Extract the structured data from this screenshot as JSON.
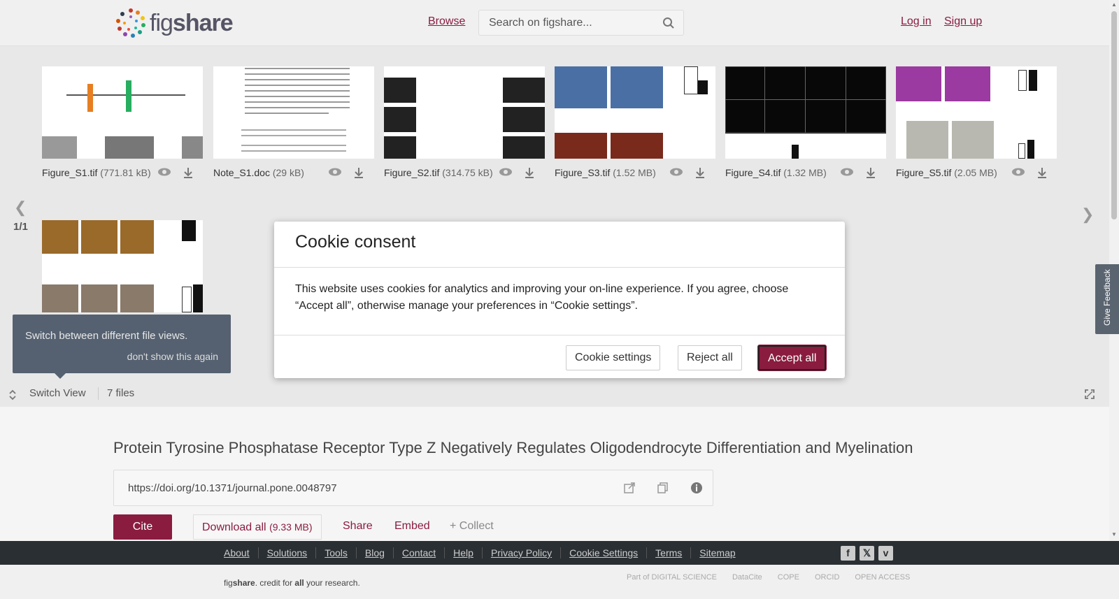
{
  "header": {
    "logo_text_fig": "fig",
    "logo_text_share": "share",
    "browse": "Browse",
    "search_placeholder": "Search on figshare...",
    "login": "Log in",
    "signup": "Sign up"
  },
  "files": [
    {
      "name": "Figure_S1.tif",
      "size": "(771.81 kB)"
    },
    {
      "name": "Note_S1.doc",
      "size": "(29 kB)"
    },
    {
      "name": "Figure_S2.tif",
      "size": "(314.75 kB)"
    },
    {
      "name": "Figure_S3.tif",
      "size": "(1.52 MB)"
    },
    {
      "name": "Figure_S4.tif",
      "size": "(1.32 MB)"
    },
    {
      "name": "Figure_S5.tif",
      "size": "(2.05 MB)"
    }
  ],
  "viewer": {
    "pager": "1/1",
    "tooltip_text": "Switch between different file views.",
    "tooltip_dismiss": "don't show this again",
    "switch_view": "Switch View",
    "file_count": "7 files"
  },
  "article": {
    "title": "Protein Tyrosine Phosphatase Receptor Type Z Negatively Regulates Oligodendrocyte Differentiation and Myelination",
    "doi": "https://doi.org/10.1371/journal.pone.0048797",
    "cite": "Cite",
    "download_all": "Download all",
    "download_size": "(9.33 MB)",
    "share": "Share",
    "embed": "Embed",
    "collect": "+ Collect"
  },
  "feedback": "Give Feedback",
  "footer": {
    "links": [
      "About",
      "Solutions",
      "Tools",
      "Blog",
      "Contact",
      "Help",
      "Privacy Policy",
      "Cookie Settings",
      "Terms",
      "Sitemap"
    ],
    "tag_fig": "fig",
    "tag_share": "share",
    "tag_rest1": ". credit for ",
    "tag_all": "all",
    "tag_rest2": " your research.",
    "partners": [
      "Part of DIGITAL SCIENCE",
      "DataCite",
      "COPE",
      "ORCID",
      "OPEN ACCESS"
    ]
  },
  "cookie": {
    "title": "Cookie consent",
    "body": "This website uses cookies for analytics and improving your on-line experience. If you agree, choose “Accept all”, otherwise manage your preferences in “Cookie settings”.",
    "settings": "Cookie settings",
    "reject": "Reject all",
    "accept": "Accept all"
  },
  "colors": {
    "brand": "#8a1c3f",
    "footer_dark": "#2a2f33"
  }
}
